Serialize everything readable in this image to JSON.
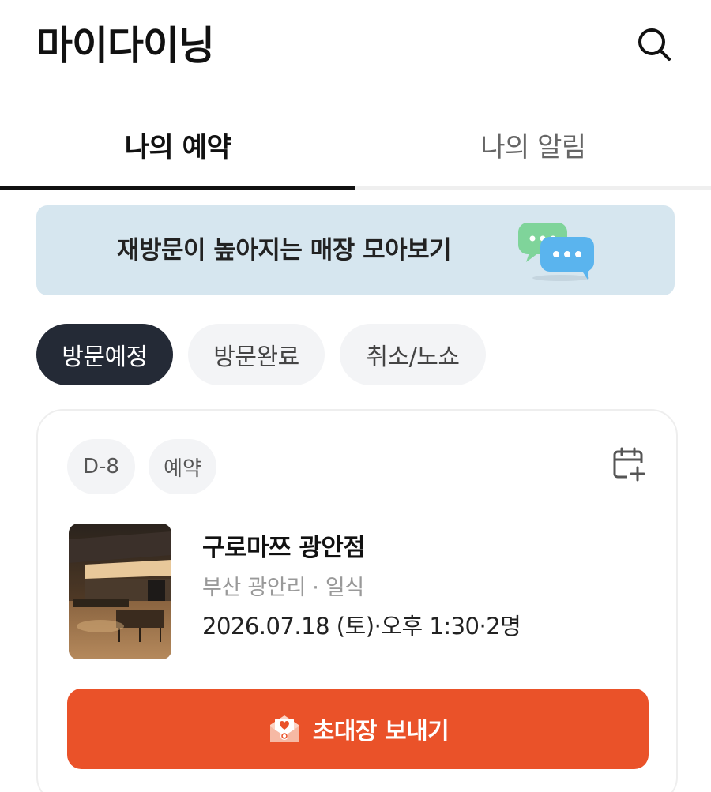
{
  "header": {
    "title": "마이다이닝",
    "search_icon": "search-icon"
  },
  "tabs": [
    {
      "label": "나의 예약",
      "active": true
    },
    {
      "label": "나의 알림",
      "active": false
    }
  ],
  "banner": {
    "text": "재방문이 높아지는 매장 모아보기",
    "icon": "chat-bubbles-icon"
  },
  "filters": [
    {
      "label": "방문예정",
      "selected": true
    },
    {
      "label": "방문완료",
      "selected": false
    },
    {
      "label": "취소/노쇼",
      "selected": false
    }
  ],
  "reservation": {
    "badges": [
      "D-8",
      "예약"
    ],
    "calendar_icon": "calendar-add-icon",
    "store_name": "구로마쯔 광안점",
    "store_meta": "부산 광안리 · 일식",
    "datetime": "2026.07.18 (토)·오후 1:30·2명",
    "invite_button": "초대장 보내기"
  },
  "colors": {
    "accent": "#ea5229",
    "chip_selected": "#242a36",
    "banner_bg": "#d6e6ef"
  }
}
